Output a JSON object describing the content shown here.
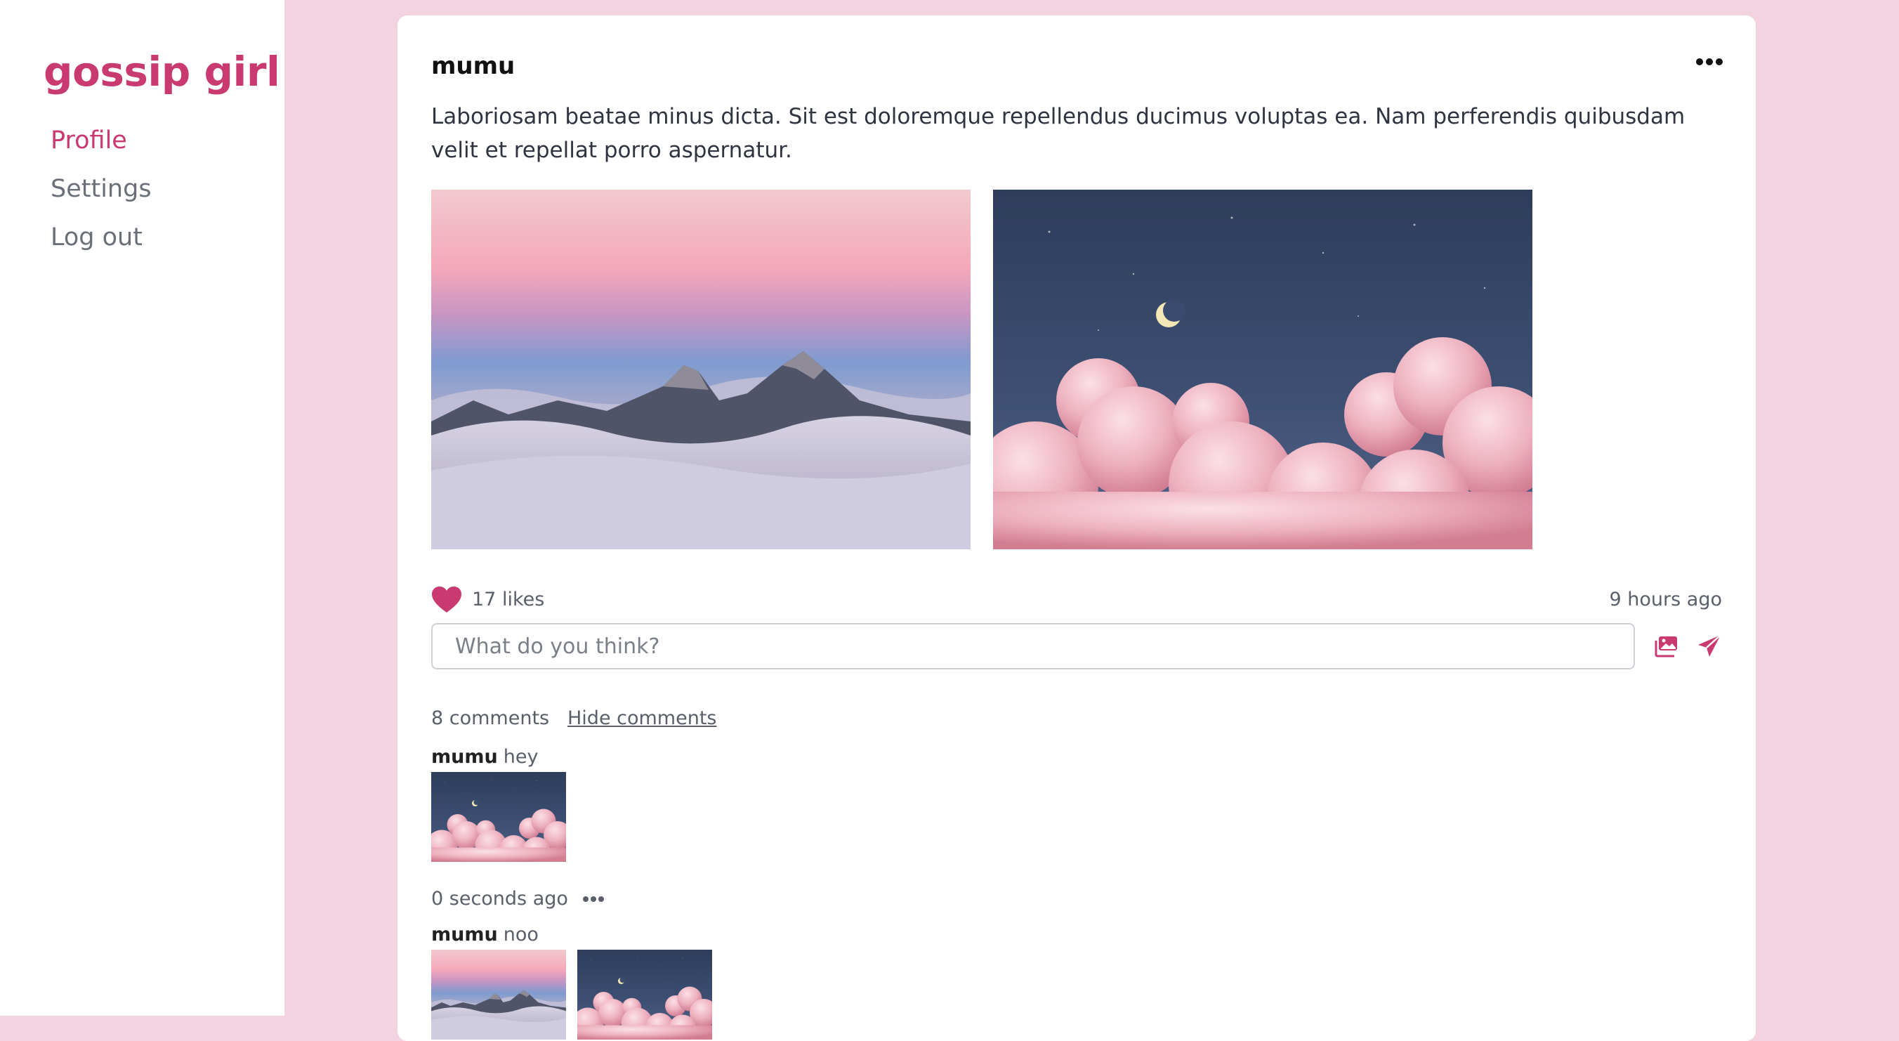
{
  "sidebar": {
    "brand": "gossip girl",
    "items": [
      {
        "label": "Profile",
        "active": true
      },
      {
        "label": "Settings",
        "active": false
      },
      {
        "label": "Log out",
        "active": false
      }
    ]
  },
  "post": {
    "author": "mumu",
    "text": "Laboriosam beatae minus dicta. Sit est doloremque repellendus ducimus voluptas ea. Nam perferendis quibusdam velit et repellat porro aspernatur.",
    "images": [
      "mountain-sunset-clouds",
      "moon-pink-clouds"
    ],
    "likes": "17 likes",
    "time": "9 hours ago",
    "comment_placeholder": "What do you think?",
    "comments_count": "8 comments",
    "hide_comments_label": "Hide comments"
  },
  "comments": [
    {
      "author": "mumu",
      "text": "hey",
      "time": "0 seconds ago",
      "images": [
        "moon-pink-clouds"
      ]
    },
    {
      "author": "mumu",
      "text": "noo",
      "images": [
        "mountain-sunset-clouds",
        "moon-pink-clouds"
      ]
    }
  ],
  "colors": {
    "accent": "#c93a71",
    "background": "#f2d3df"
  }
}
